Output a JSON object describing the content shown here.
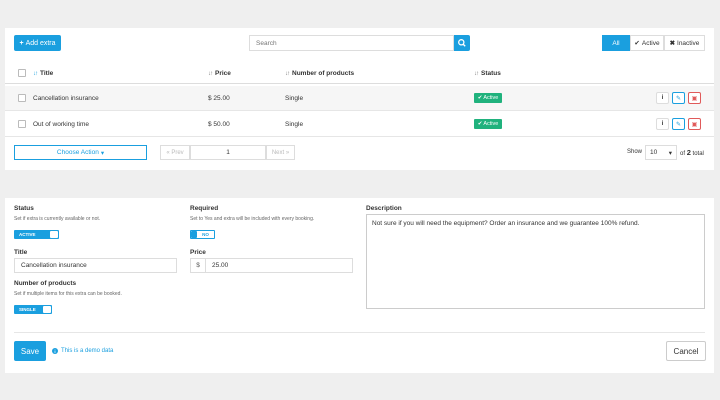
{
  "toolbar": {
    "add_label": "Add extra",
    "search_placeholder": "Search",
    "filters": [
      "All",
      "Active",
      "Inactive"
    ]
  },
  "table": {
    "columns": [
      "Title",
      "Price",
      "Number of products",
      "Status"
    ],
    "rows": [
      {
        "title": "Cancellation insurance",
        "price": "$ 25.00",
        "products": "Single",
        "status": "Active"
      },
      {
        "title": "Out of working time",
        "price": "$ 50.00",
        "products": "Single",
        "status": "Active"
      }
    ]
  },
  "footer": {
    "choose_action": "Choose Action",
    "prev": "« Prev",
    "page": "1",
    "next": "Next »",
    "show_label": "Show",
    "show_value": "10",
    "of_label": "of",
    "total_count": "2",
    "total_label": "total"
  },
  "form": {
    "status_label": "Status",
    "status_help": "Set if extra is currently available or not.",
    "status_toggle": "ACTIVE",
    "required_label": "Required",
    "required_help": "Set to Yes and extra will be included with every booking.",
    "required_toggle": "NO",
    "title_label": "Title",
    "title_value": "Cancellation insurance",
    "price_label": "Price",
    "price_currency": "$",
    "price_value": "25.00",
    "products_label": "Number of products",
    "products_help": "Set if multiple items for this extra can be booked.",
    "products_toggle": "SINGLE",
    "description_label": "Description",
    "description_value": "Not sure if you will need the equipment? Order an insurance and we guarantee 100% refund.",
    "save_label": "Save",
    "demo_note": "This is a demo data",
    "cancel_label": "Cancel"
  },
  "colors": {
    "accent": "#1a9fdf",
    "active_badge": "#20b27d",
    "delete": "#e05a5a"
  }
}
